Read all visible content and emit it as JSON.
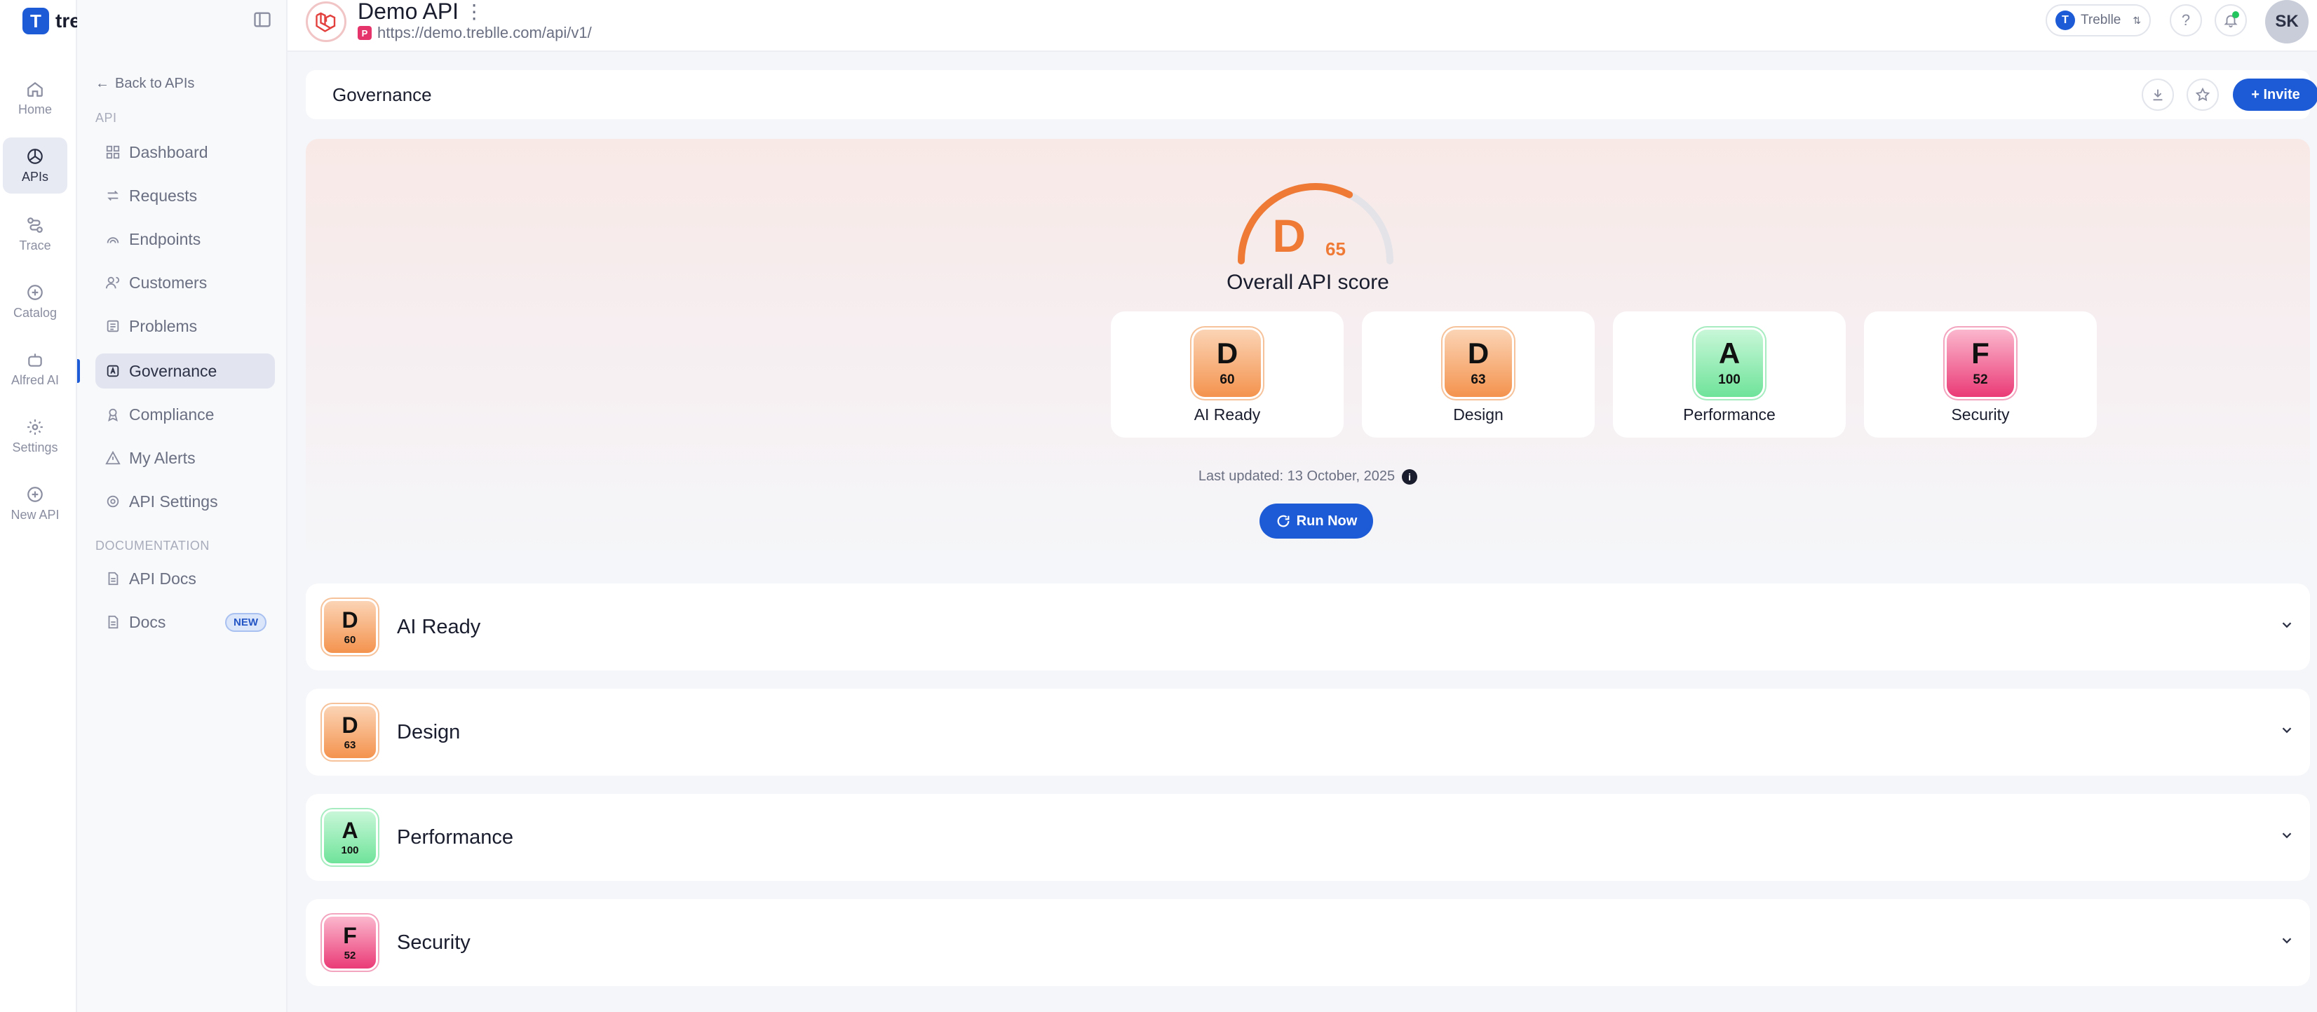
{
  "brand": {
    "name": "treblle",
    "mark": "T"
  },
  "rail": [
    {
      "label": "Home",
      "icon": "home-icon"
    },
    {
      "label": "APIs",
      "icon": "apis-icon",
      "active": true
    },
    {
      "label": "Trace",
      "icon": "trace-icon"
    },
    {
      "label": "Catalog",
      "icon": "catalog-icon"
    },
    {
      "label": "Alfred AI",
      "icon": "robot-icon"
    },
    {
      "label": "Settings",
      "icon": "gear-icon"
    },
    {
      "label": "New API",
      "icon": "plus-circle-icon"
    }
  ],
  "sidebar": {
    "back": "Back to APIs",
    "section_api": "API",
    "items": [
      {
        "label": "Dashboard",
        "icon": "grid-icon"
      },
      {
        "label": "Requests",
        "icon": "arrows-icon"
      },
      {
        "label": "Endpoints",
        "icon": "endpoint-icon"
      },
      {
        "label": "Customers",
        "icon": "users-icon"
      },
      {
        "label": "Problems",
        "icon": "problem-icon"
      },
      {
        "label": "Governance",
        "icon": "governance-icon",
        "active": true
      },
      {
        "label": "Compliance",
        "icon": "compliance-icon"
      },
      {
        "label": "My Alerts",
        "icon": "alert-icon"
      },
      {
        "label": "API Settings",
        "icon": "gear-icon"
      }
    ],
    "section_docs": "DOCUMENTATION",
    "docs": [
      {
        "label": "API Docs",
        "icon": "doc-icon"
      },
      {
        "label": "Docs",
        "icon": "doc-icon",
        "badge": "NEW"
      }
    ]
  },
  "header": {
    "api_name": "Demo API",
    "kebab": "⋮",
    "url_badge": "P",
    "url": "https://demo.treblle.com/api/v1/",
    "workspace": "Treblle",
    "workspace_mark": "T",
    "help": "?",
    "avatar": "SK"
  },
  "page": {
    "title": "Governance",
    "invite_label": "+ Invite"
  },
  "score": {
    "grade": "D",
    "value": 65,
    "value_text": "65",
    "label": "Overall API score",
    "color": "#ef7a36"
  },
  "categories": [
    {
      "label": "AI Ready",
      "grade": "D",
      "score": "60",
      "tone": "D"
    },
    {
      "label": "Design",
      "grade": "D",
      "score": "63",
      "tone": "D"
    },
    {
      "label": "Performance",
      "grade": "A",
      "score": "100",
      "tone": "A"
    },
    {
      "label": "Security",
      "grade": "F",
      "score": "52",
      "tone": "F"
    }
  ],
  "updated": {
    "text": "Last updated: 13 October, 2025",
    "info": "i"
  },
  "run_label": "Run Now",
  "colors": {
    "accent": "#1d5bd6",
    "grade_D": "#f4934e",
    "grade_A": "#6fe39a",
    "grade_F": "#ea3b77"
  }
}
